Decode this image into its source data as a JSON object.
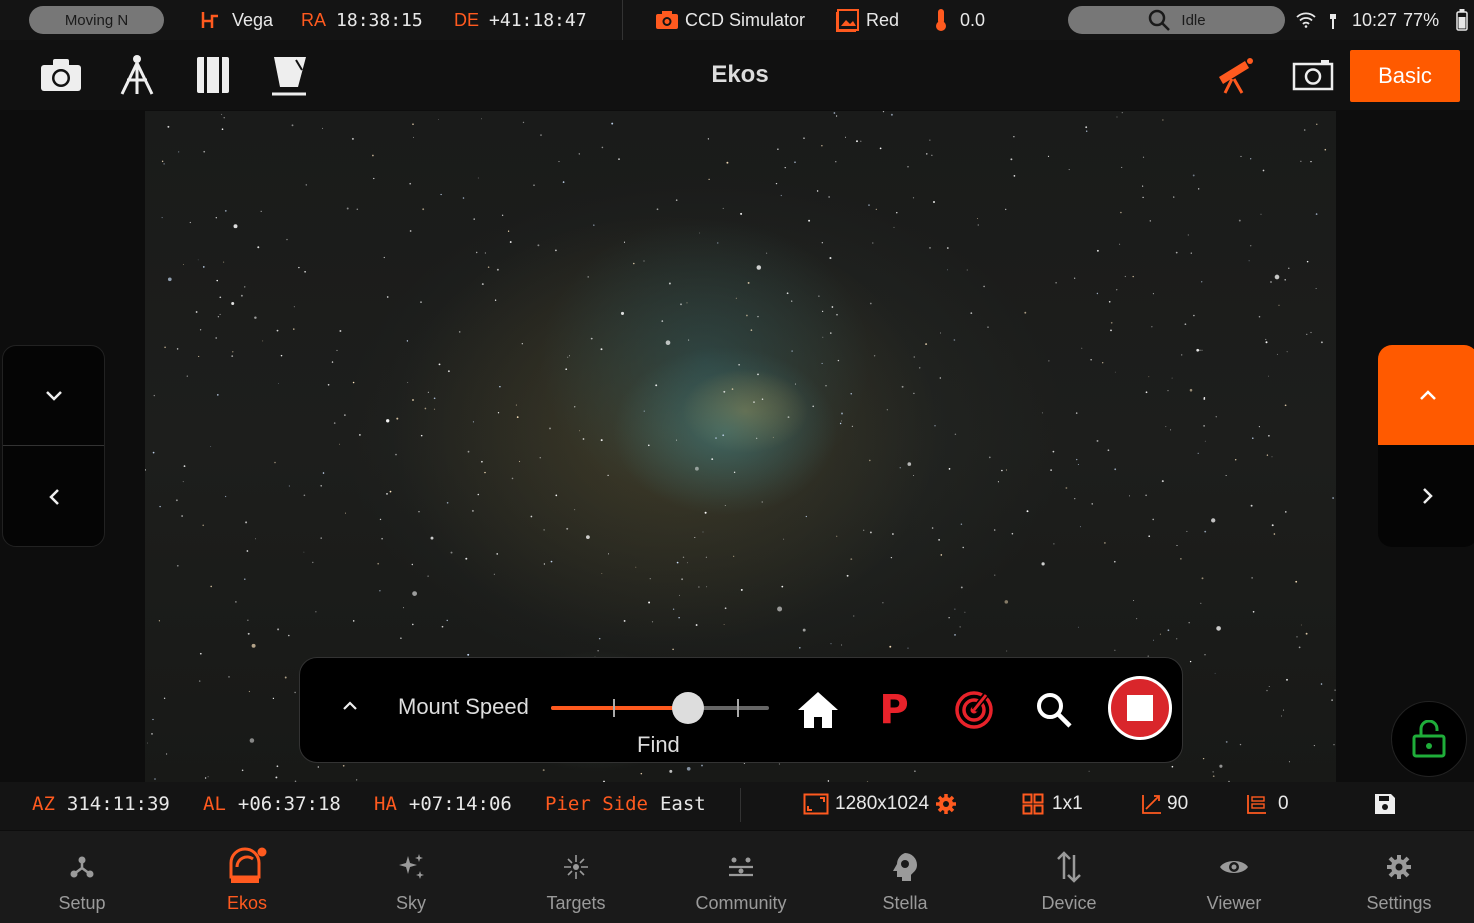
{
  "status_bar": {
    "mount_status": "Moving N",
    "target_name": "Vega",
    "ra_label": "RA",
    "ra_value": "18:38:15",
    "de_label": "DE",
    "de_value": "+41:18:47",
    "camera_name": "CCD Simulator",
    "filter_name": "Red",
    "temperature": "0.0",
    "capture_state": "Idle",
    "time": "10:27",
    "battery": "77%"
  },
  "toolbar": {
    "title": "Ekos",
    "mode_label": "Basic"
  },
  "mount_panel": {
    "speed_label": "Mount Speed",
    "speed_value": "Find",
    "speed_level": 0.63,
    "park_label": "P"
  },
  "info_bar": {
    "az_label": "AZ",
    "az_value": "314:11:39",
    "al_label": "AL",
    "al_value": "+06:37:18",
    "ha_label": "HA",
    "ha_value": "+07:14:06",
    "pier_label": "Pier Side",
    "pier_value": "East",
    "resolution": "1280x1024",
    "binning": "1x1",
    "angle": "90",
    "offset": "0"
  },
  "bottom_nav": {
    "items": [
      {
        "label": "Setup",
        "icon": "setup-icon"
      },
      {
        "label": "Ekos",
        "icon": "ekos-icon",
        "active": true
      },
      {
        "label": "Sky",
        "icon": "sky-icon"
      },
      {
        "label": "Targets",
        "icon": "targets-icon"
      },
      {
        "label": "Community",
        "icon": "community-icon"
      },
      {
        "label": "Stella",
        "icon": "stella-icon"
      },
      {
        "label": "Device",
        "icon": "device-icon"
      },
      {
        "label": "Viewer",
        "icon": "viewer-icon"
      },
      {
        "label": "Settings",
        "icon": "settings-icon"
      }
    ]
  },
  "colors": {
    "accent": "#ff5a1f",
    "stop_red": "#d9262b",
    "lock_green": "#1fae3a",
    "background": "#0d0d0d"
  }
}
